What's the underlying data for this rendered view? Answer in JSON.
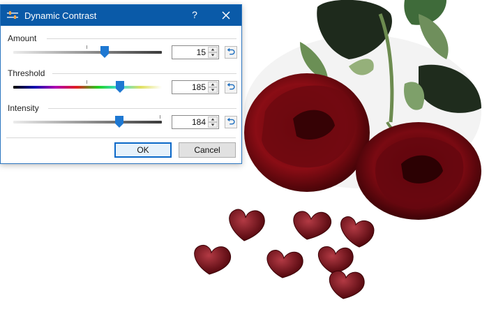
{
  "dialog": {
    "title": "Dynamic Contrast",
    "help_label": "?",
    "close_icon": "close-icon",
    "app_icon": "adjust-sliders-icon"
  },
  "controls": [
    {
      "label": "Amount",
      "value": "15",
      "level_fraction": 0.62,
      "track": "gray-gradient"
    },
    {
      "label": "Threshold",
      "value": "185",
      "level_fraction": 0.72,
      "track": "hue-gradient"
    },
    {
      "label": "Intensity",
      "value": "184",
      "level_fraction": 0.72,
      "track": "gray-gradient"
    }
  ],
  "buttons": {
    "ok_label": "OK",
    "cancel_label": "Cancel"
  },
  "colors": {
    "titlebar": "#0a5aa8",
    "accent": "#0a68c8",
    "rose": "#7a0c12"
  }
}
